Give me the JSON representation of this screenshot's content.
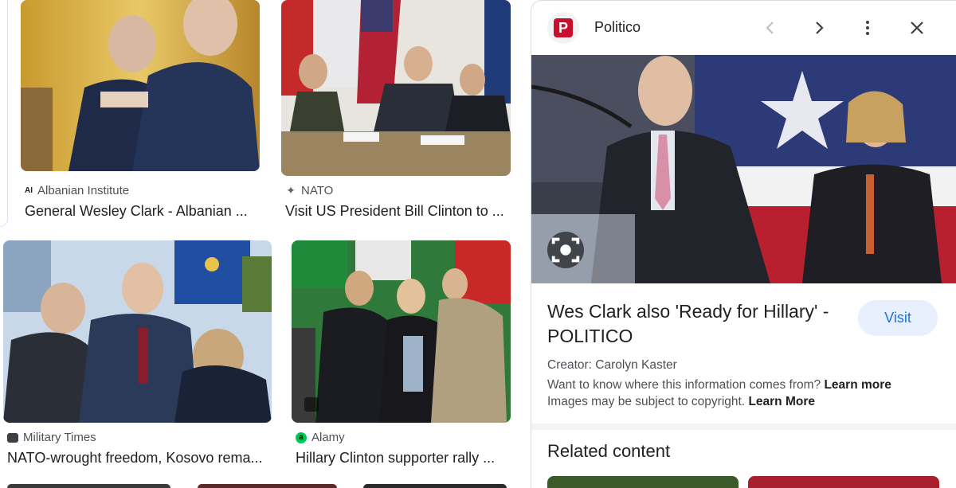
{
  "results": [
    {
      "source": "Albanian Institute",
      "source_icon_text": "AI",
      "caption": "General Wesley Clark - Albanian ..."
    },
    {
      "source": "NATO",
      "source_icon_text": "✦",
      "caption": "Visit US President Bill Clinton to ..."
    },
    {
      "source": "Military Times",
      "source_icon_text": "",
      "caption": "NATO-wrought freedom, Kosovo rema..."
    },
    {
      "source": "Alamy",
      "source_icon_text": "a",
      "caption": "Hillary Clinton supporter rally ..."
    }
  ],
  "preview": {
    "site_name": "Politico",
    "logo_letter": "P",
    "title": "Wes Clark also 'Ready for Hillary' - POLITICO",
    "visit_label": "Visit",
    "creator": "Creator: Carolyn Kaster",
    "info_text": "Want to know where this information comes from?",
    "info_link": "Learn more",
    "copyright_text": "Images may be subject to copyright.",
    "copyright_link": "Learn More",
    "related_heading": "Related content"
  },
  "colors": {
    "accent": "#1a73e8",
    "visit_bg": "#e8f0fe",
    "politico_red": "#c8102e",
    "alamy_green": "#00c853"
  },
  "icons": [
    "camera-lens-icon",
    "chevron-left-icon",
    "chevron-right-icon",
    "more-vert-icon",
    "close-icon",
    "image-badge-icon"
  ]
}
